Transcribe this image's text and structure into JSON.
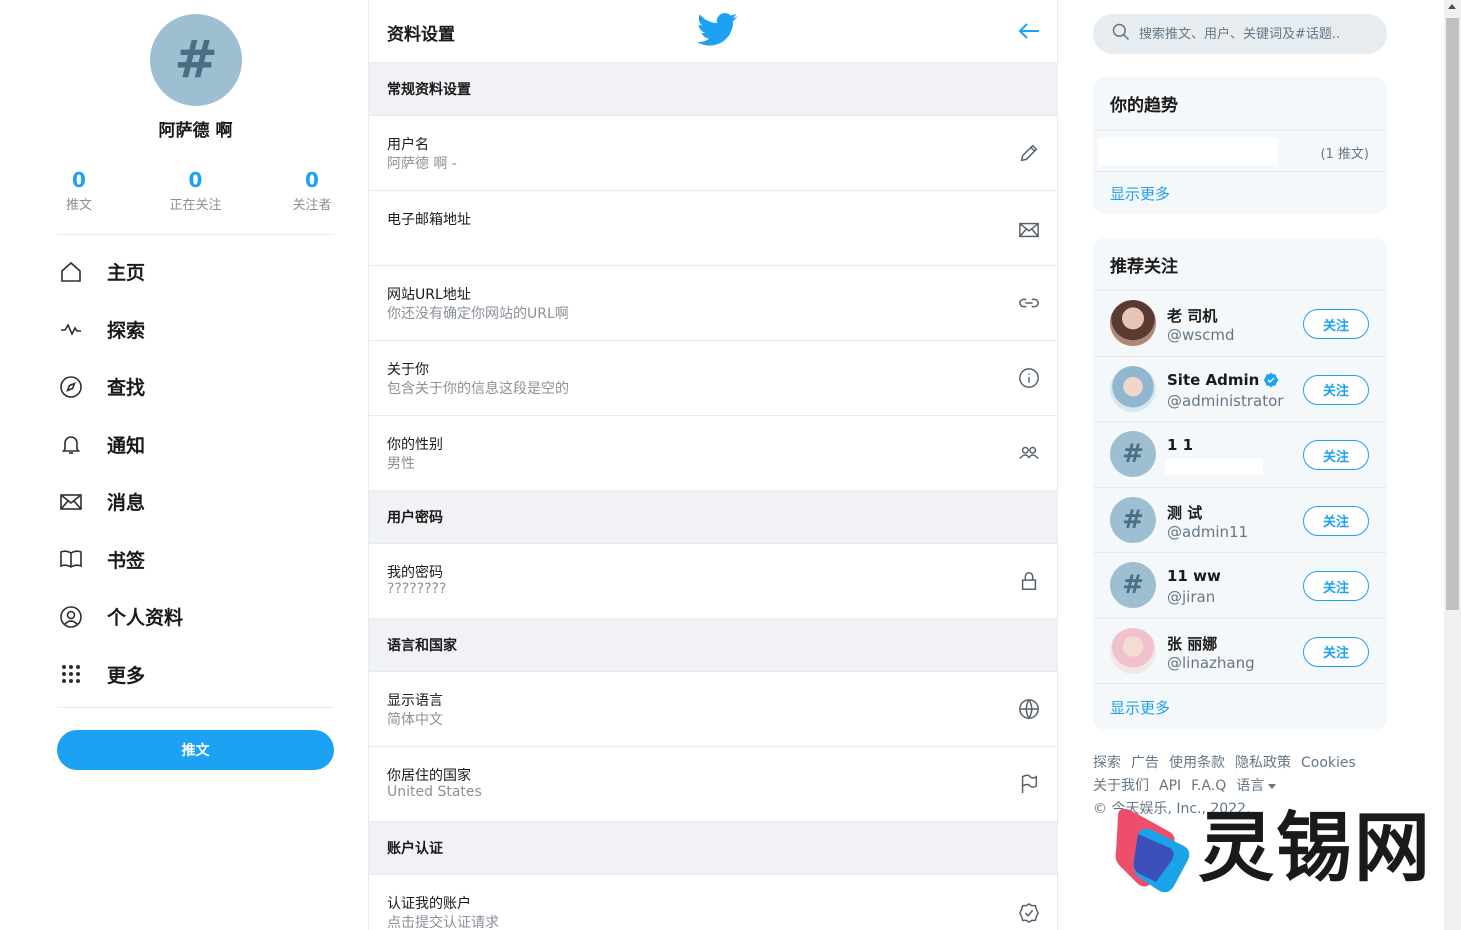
{
  "profile": {
    "avatar_glyph": "#",
    "name": "阿萨德 啊",
    "stats": [
      {
        "num": "0",
        "label": "推文"
      },
      {
        "num": "0",
        "label": "正在关注"
      },
      {
        "num": "0",
        "label": "关注者"
      }
    ]
  },
  "nav": [
    {
      "label": "主页",
      "icon": "home-icon"
    },
    {
      "label": "探索",
      "icon": "pulse-icon"
    },
    {
      "label": "查找",
      "icon": "compass-icon"
    },
    {
      "label": "通知",
      "icon": "bell-icon"
    },
    {
      "label": "消息",
      "icon": "mail-icon"
    },
    {
      "label": "书签",
      "icon": "book-icon"
    },
    {
      "label": "个人资料",
      "icon": "user-circle-icon"
    },
    {
      "label": "更多",
      "icon": "dots-grid-icon"
    }
  ],
  "tweet_button": "推文",
  "settings": {
    "title": "资料设置",
    "sections": [
      {
        "title": "常规资料设置",
        "rows": [
          {
            "label": "用户名",
            "value": "阿萨德 啊 -",
            "icon": "pencil-icon"
          },
          {
            "label": "电子邮箱地址",
            "value": "",
            "icon": "envelope-icon"
          },
          {
            "label": "网站URL地址",
            "value": "你还没有确定你网站的URL啊",
            "icon": "link-icon"
          },
          {
            "label": "关于你",
            "value": "包含关于你的信息这段是空的",
            "icon": "info-icon"
          },
          {
            "label": "你的性别",
            "value": "男性",
            "icon": "people-icon"
          }
        ]
      },
      {
        "title": "用户密码",
        "rows": [
          {
            "label": "我的密码",
            "value": "????????",
            "icon": "lock-icon"
          }
        ]
      },
      {
        "title": "语言和国家",
        "rows": [
          {
            "label": "显示语言",
            "value": "简体中文",
            "icon": "globe-icon"
          },
          {
            "label": "你居住的国家",
            "value": "United States",
            "icon": "flag-icon"
          }
        ]
      },
      {
        "title": "账户认证",
        "rows": [
          {
            "label": "认证我的账户",
            "value": "点击提交认证请求",
            "icon": "badge-check-icon"
          }
        ]
      }
    ]
  },
  "search": {
    "placeholder": "搜索推文、用户、关键词及#话题.."
  },
  "trends": {
    "title": "你的趋势",
    "items": [
      {
        "count": "(1 推文)"
      }
    ],
    "show_more": "显示更多"
  },
  "recommend": {
    "title": "推荐关注",
    "users": [
      {
        "name": "老 司机",
        "handle": "@wscmd",
        "verified": false,
        "avatar": "photo1"
      },
      {
        "name": "Site Admin",
        "handle": "@administrator",
        "verified": true,
        "avatar": "photo2"
      },
      {
        "name": "1 1",
        "handle": "",
        "verified": false,
        "avatar": "hash"
      },
      {
        "name": "测 试",
        "handle": "@admin11",
        "verified": false,
        "avatar": "hash"
      },
      {
        "name": "11 ww",
        "handle": "@jiran",
        "verified": false,
        "avatar": "hash"
      },
      {
        "name": "张 丽娜",
        "handle": "@linazhang",
        "verified": false,
        "avatar": "photo3"
      }
    ],
    "follow_label": "关注",
    "show_more": "显示更多"
  },
  "footer": {
    "links1": [
      "探索",
      "广告",
      "使用条款",
      "隐私政策",
      "Cookies"
    ],
    "links2": [
      "关于我们",
      "API",
      "F.A.Q",
      "语言"
    ],
    "copyright": "© 今天娱乐, Inc., 2022."
  },
  "watermark": {
    "text": "灵锡网"
  },
  "colors": {
    "accent": "#1da1f2",
    "section_bg": "#f0f2f5",
    "card_bg": "#f5f8fa"
  }
}
